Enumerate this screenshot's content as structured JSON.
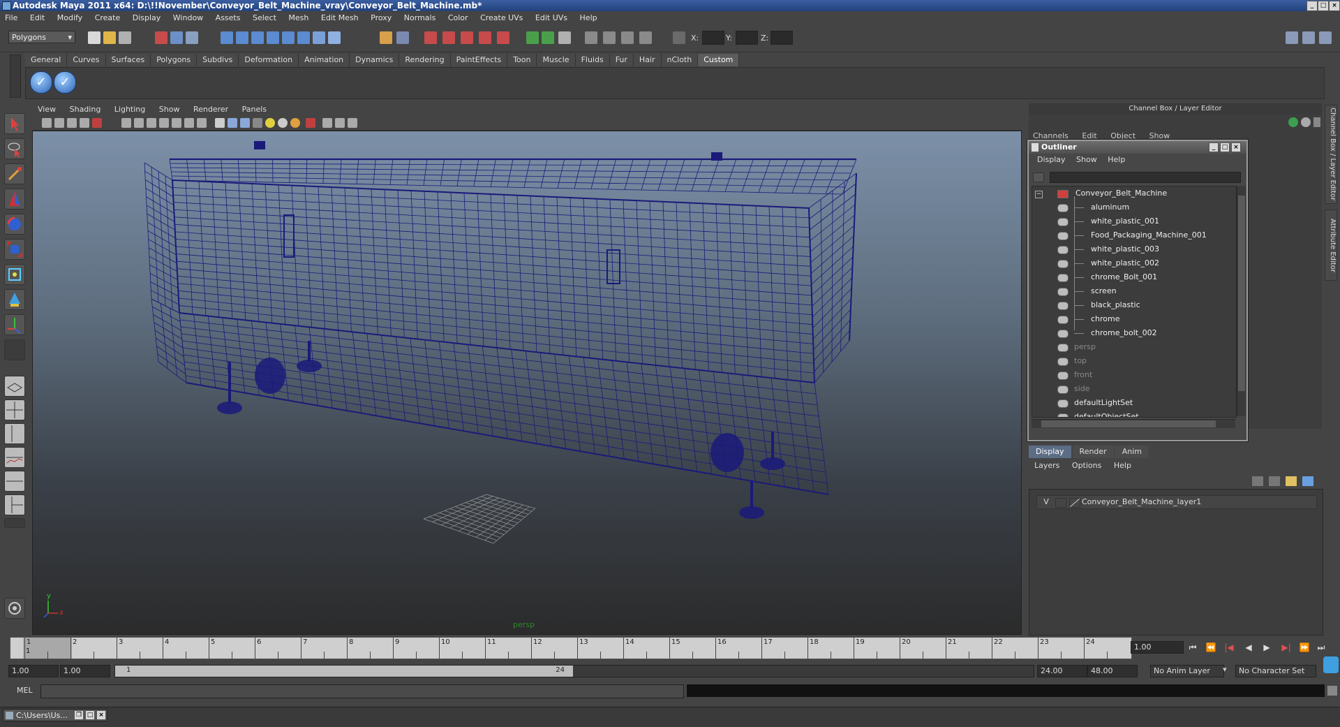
{
  "window": {
    "title": "Autodesk Maya 2011 x64: D:\\!!November\\Conveyor_Belt_Machine_vray\\Conveyor_Belt_Machine.mb*",
    "buttons": [
      "minimize-icon",
      "maximize-icon",
      "close-icon"
    ]
  },
  "menubar": [
    "File",
    "Edit",
    "Modify",
    "Create",
    "Display",
    "Window",
    "Assets",
    "Select",
    "Mesh",
    "Edit Mesh",
    "Proxy",
    "Normals",
    "Color",
    "Create UVs",
    "Edit UVs",
    "Help"
  ],
  "statusline": {
    "mode": "Polygons",
    "x_label": "X:",
    "y_label": "Y:",
    "z_label": "Z:"
  },
  "shelf": {
    "tabs": [
      "General",
      "Curves",
      "Surfaces",
      "Polygons",
      "Subdivs",
      "Deformation",
      "Animation",
      "Dynamics",
      "Rendering",
      "PaintEffects",
      "Toon",
      "Muscle",
      "Fluids",
      "Fur",
      "Hair",
      "nCloth",
      "Custom"
    ],
    "active_tab": "Custom",
    "icons": [
      "checkmark-icon",
      "checkmark-icon"
    ]
  },
  "viewport": {
    "menu": [
      "View",
      "Shading",
      "Lighting",
      "Show",
      "Renderer",
      "Panels"
    ],
    "camera_label": "persp",
    "axis_y": "y",
    "axis_x": "x",
    "wire_color": "#1a1a7a"
  },
  "channel_box": {
    "header": "Channel Box / Layer Editor",
    "menu": [
      "Channels",
      "Edit",
      "Object",
      "Show"
    ],
    "side_tabs": [
      "Channel Box / Layer Editor",
      "Attribute Editor"
    ]
  },
  "outliner": {
    "title": "Outliner",
    "menu": [
      "Display",
      "Show",
      "Help"
    ],
    "root": "Conveyor_Belt_Machine",
    "children": [
      "aluminum",
      "white_plastic_001",
      "Food_Packaging_Machine_001",
      "white_plastic_003",
      "white_plastic_002",
      "chrome_Bolt_001",
      "screen",
      "black_plastic",
      "chrome",
      "chrome_bolt_002"
    ],
    "cameras": [
      "persp",
      "top",
      "front",
      "side"
    ],
    "sets": [
      "defaultLightSet",
      "defaultObjectSet"
    ]
  },
  "layer_editor": {
    "tabs": [
      "Display",
      "Render",
      "Anim"
    ],
    "active_tab": "Display",
    "menu": [
      "Layers",
      "Options",
      "Help"
    ],
    "layer_visible": "V",
    "layer_name": "Conveyor_Belt_Machine_layer1"
  },
  "timeline": {
    "frames": [
      "1",
      "2",
      "3",
      "4",
      "5",
      "6",
      "7",
      "8",
      "9",
      "10",
      "11",
      "12",
      "13",
      "14",
      "15",
      "16",
      "17",
      "18",
      "19",
      "20",
      "21",
      "22",
      "23",
      "24"
    ],
    "current_frame": "1.00",
    "current_marker": "1"
  },
  "range": {
    "start": "1.00",
    "anim_start": "1.00",
    "thumb_start": "1",
    "thumb_end": "24",
    "end": "24.00",
    "anim_end": "48.00",
    "anim_layer": "No Anim Layer",
    "char_set": "No Character Set"
  },
  "command_line": {
    "label": "MEL"
  },
  "taskbar": {
    "item": "C:\\Users\\Us..."
  }
}
